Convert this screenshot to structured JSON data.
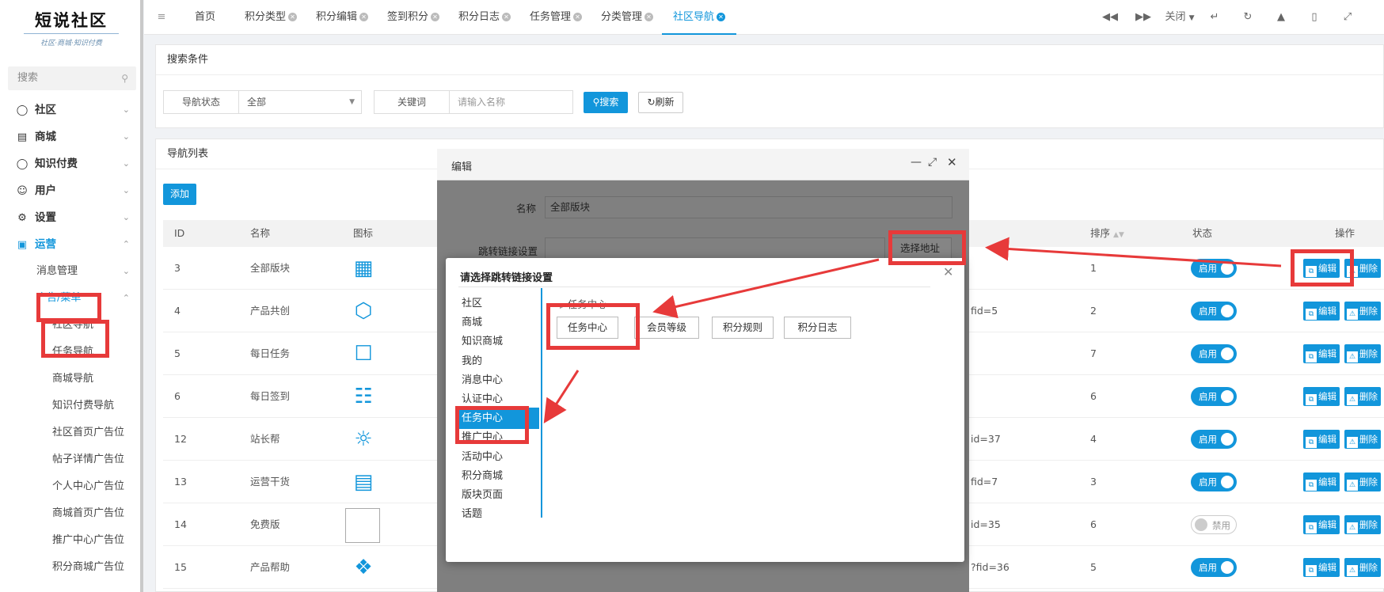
{
  "app": {
    "logo_title": "短说社区",
    "logo_slogan": "社区·商城·知识付费"
  },
  "sidebar": {
    "search_placeholder": "搜索",
    "items": [
      {
        "label": "社区",
        "icon": "chat-icon"
      },
      {
        "label": "商城",
        "icon": "store-icon"
      },
      {
        "label": "知识付费",
        "icon": "bulb-icon"
      },
      {
        "label": "用户",
        "icon": "users-icon"
      },
      {
        "label": "设置",
        "icon": "gear-icon"
      },
      {
        "label": "运营",
        "icon": "monitor-icon"
      }
    ],
    "sub_message": "消息管理",
    "sub_ad": "广告/菜单",
    "subsub": [
      "社区导航",
      "任务导航",
      "商城导航",
      "知识付费导航",
      "社区首页广告位",
      "帖子详情广告位",
      "个人中心广告位",
      "商城首页广告位",
      "推广中心广告位",
      "积分商城广告位"
    ]
  },
  "tabs": [
    {
      "label": "首页",
      "closable": false
    },
    {
      "label": "积分类型",
      "closable": true
    },
    {
      "label": "积分编辑",
      "closable": true
    },
    {
      "label": "签到积分",
      "closable": true
    },
    {
      "label": "积分日志",
      "closable": true
    },
    {
      "label": "任务管理",
      "closable": true
    },
    {
      "label": "分类管理",
      "closable": true
    },
    {
      "label": "社区导航",
      "closable": true,
      "active": true
    }
  ],
  "toolbar": {
    "close_label": "关闭"
  },
  "search_panel": {
    "title": "搜索条件",
    "status_label": "导航状态",
    "status_value": "全部",
    "keyword_label": "关键词",
    "keyword_placeholder": "请输入名称",
    "search_btn": "搜索",
    "refresh_btn": "刷新"
  },
  "list_panel": {
    "title": "导航列表",
    "add_btn": "添加",
    "headers": {
      "id": "ID",
      "name": "名称",
      "icon": "图标",
      "sort": "排序",
      "status": "状态",
      "ops": "操作"
    },
    "rows": [
      {
        "id": "3",
        "name": "全部版块",
        "icon": "grid-icon",
        "link": "",
        "sort": "1",
        "status": "启用",
        "on": true
      },
      {
        "id": "4",
        "name": "产品共创",
        "icon": "cube-icon",
        "link": "fid=5",
        "sort": "2",
        "status": "启用",
        "on": true
      },
      {
        "id": "5",
        "name": "每日任务",
        "icon": "clipboard-icon",
        "link": "",
        "sort": "7",
        "status": "启用",
        "on": true
      },
      {
        "id": "6",
        "name": "每日签到",
        "icon": "calendar-icon",
        "link": "",
        "sort": "6",
        "status": "启用",
        "on": true
      },
      {
        "id": "12",
        "name": "站长帮",
        "icon": "sun-icon",
        "link": "id=37",
        "sort": "4",
        "status": "启用",
        "on": true
      },
      {
        "id": "13",
        "name": "运营干货",
        "icon": "chart-screen-icon",
        "link": "fid=7",
        "sort": "3",
        "status": "启用",
        "on": true
      },
      {
        "id": "14",
        "name": "免费版",
        "icon": "broken-image-icon",
        "link": "id=35",
        "sort": "6",
        "status": "禁用",
        "on": false
      },
      {
        "id": "15",
        "name": "产品帮助",
        "icon": "handshake-icon",
        "link": "?fid=36",
        "sort": "5",
        "status": "启用",
        "on": true
      }
    ],
    "edit_btn": "编辑",
    "del_btn": "删除"
  },
  "edit_dialog": {
    "title": "编辑",
    "name_label": "名称",
    "name_value": "全部版块",
    "link_label": "跳转链接设置",
    "choose_btn": "选择地址"
  },
  "link_dialog": {
    "title": "请选择跳转链接设置",
    "categories": [
      "社区",
      "商城",
      "知识商城",
      "我的",
      "消息中心",
      "认证中心",
      "任务中心",
      "推广中心",
      "活动中心",
      "积分商城",
      "版块页面",
      "话题"
    ],
    "selected_category": "任务中心",
    "section_title": "任务中心",
    "links": [
      "任务中心",
      "会员等级",
      "积分规则",
      "积分日志"
    ]
  },
  "colors": {
    "accent": "#1296db",
    "annotation_red": "#e73a3a"
  }
}
